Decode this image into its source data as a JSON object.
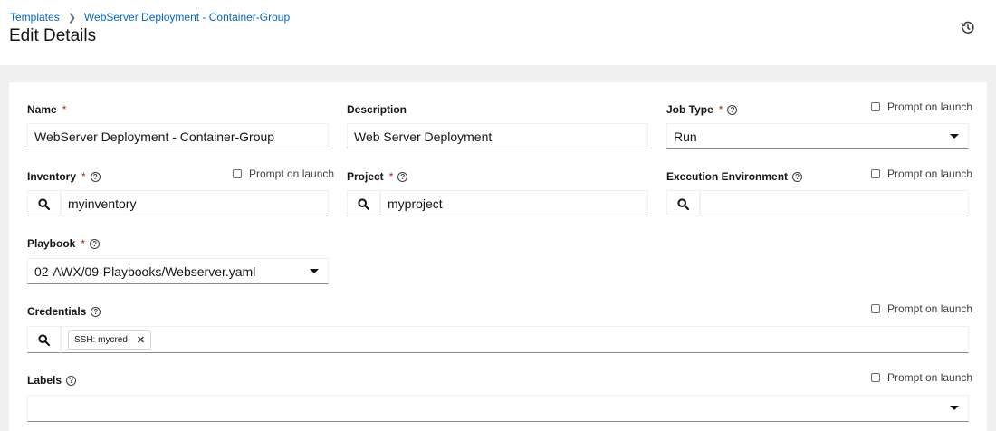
{
  "breadcrumb": {
    "root": "Templates",
    "current": "WebServer Deployment - Container-Group"
  },
  "page_title": "Edit Details",
  "form": {
    "name": {
      "label": "Name",
      "value": "WebServer Deployment - Container-Group"
    },
    "description": {
      "label": "Description",
      "value": "Web Server Deployment"
    },
    "job_type": {
      "label": "Job Type",
      "value": "Run"
    },
    "inventory": {
      "label": "Inventory",
      "value": "myinventory"
    },
    "project": {
      "label": "Project",
      "value": "myproject"
    },
    "execution_environment": {
      "label": "Execution Environment",
      "value": ""
    },
    "playbook": {
      "label": "Playbook",
      "value": "02-AWX/09-Playbooks/Webserver.yaml"
    },
    "credentials": {
      "label": "Credentials",
      "chip_type": "SSH:",
      "chip_name": "mycred"
    },
    "labels": {
      "label": "Labels"
    },
    "prompt_on_launch": "Prompt on launch",
    "required_mark": "*",
    "help_glyph": "?"
  },
  "icons": {
    "history": "history-icon",
    "search": "search-icon",
    "caret": "caret-down-icon",
    "close": "close-icon"
  },
  "colors": {
    "link": "#0066cc",
    "required": "#c9190b",
    "page_bg": "#f0f0f0"
  }
}
